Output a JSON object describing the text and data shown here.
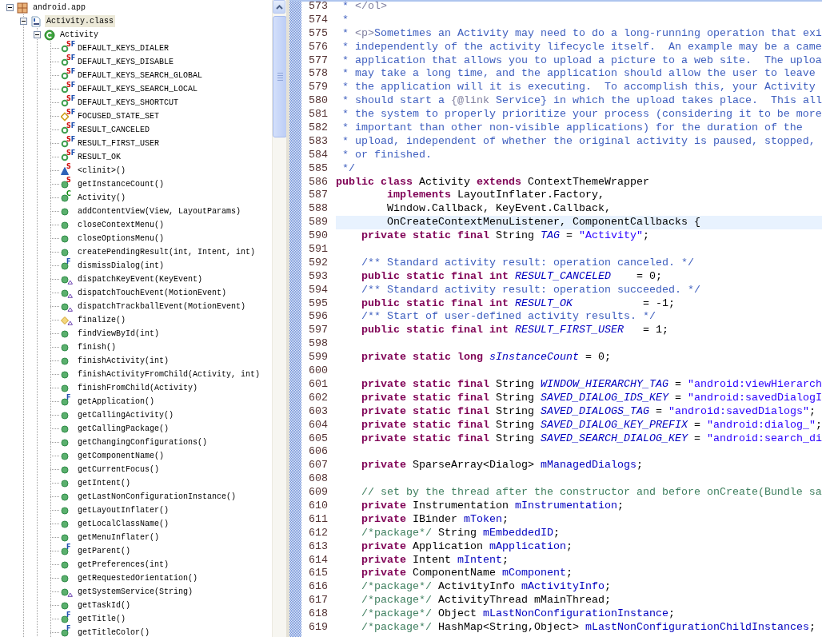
{
  "outline": {
    "label": "android.app",
    "kind": "package",
    "expanded": true,
    "selected": false,
    "children": [
      {
        "label": "Activity.class",
        "kind": "classfile",
        "expanded": true,
        "selected": true,
        "children": [
          {
            "label": "Activity",
            "kind": "class",
            "expanded": true,
            "selected": false,
            "children": [
              {
                "label": "DEFAULT_KEYS_DIALER",
                "kind": "public-field",
                "badges": [
                  {
                    "text": "S",
                    "kind": "static"
                  },
                  {
                    "text": "F",
                    "kind": "final"
                  }
                ],
                "overrides": false,
                "selected": false
              },
              {
                "label": "DEFAULT_KEYS_DISABLE",
                "kind": "public-field",
                "badges": [
                  {
                    "text": "S",
                    "kind": "static"
                  },
                  {
                    "text": "F",
                    "kind": "final"
                  }
                ],
                "overrides": false,
                "selected": false
              },
              {
                "label": "DEFAULT_KEYS_SEARCH_GLOBAL",
                "kind": "public-field",
                "badges": [
                  {
                    "text": "S",
                    "kind": "static"
                  },
                  {
                    "text": "F",
                    "kind": "final"
                  }
                ],
                "overrides": false,
                "selected": false
              },
              {
                "label": "DEFAULT_KEYS_SEARCH_LOCAL",
                "kind": "public-field",
                "badges": [
                  {
                    "text": "S",
                    "kind": "static"
                  },
                  {
                    "text": "F",
                    "kind": "final"
                  }
                ],
                "overrides": false,
                "selected": false
              },
              {
                "label": "DEFAULT_KEYS_SHORTCUT",
                "kind": "public-field",
                "badges": [
                  {
                    "text": "S",
                    "kind": "static"
                  },
                  {
                    "text": "F",
                    "kind": "final"
                  }
                ],
                "overrides": false,
                "selected": false
              },
              {
                "label": "FOCUSED_STATE_SET",
                "kind": "protected-field",
                "badges": [
                  {
                    "text": "S",
                    "kind": "static"
                  },
                  {
                    "text": "F",
                    "kind": "final"
                  }
                ],
                "overrides": false,
                "selected": false
              },
              {
                "label": "RESULT_CANCELED",
                "kind": "public-field",
                "badges": [
                  {
                    "text": "S",
                    "kind": "static"
                  },
                  {
                    "text": "F",
                    "kind": "final"
                  }
                ],
                "overrides": false,
                "selected": false
              },
              {
                "label": "RESULT_FIRST_USER",
                "kind": "public-field",
                "badges": [
                  {
                    "text": "S",
                    "kind": "static"
                  },
                  {
                    "text": "F",
                    "kind": "final"
                  }
                ],
                "overrides": false,
                "selected": false
              },
              {
                "label": "RESULT_OK",
                "kind": "public-field",
                "badges": [
                  {
                    "text": "S",
                    "kind": "static"
                  },
                  {
                    "text": "F",
                    "kind": "final"
                  }
                ],
                "overrides": false,
                "selected": false
              },
              {
                "label": "<clinit>()",
                "kind": "default-method",
                "badges": [
                  {
                    "text": "S",
                    "kind": "static"
                  }
                ],
                "overrides": false,
                "selected": false
              },
              {
                "label": "getInstanceCount()",
                "kind": "public-method",
                "badges": [
                  {
                    "text": "S",
                    "kind": "static"
                  }
                ],
                "overrides": false,
                "selected": false
              },
              {
                "label": "Activity()",
                "kind": "public-method",
                "badges": [
                  {
                    "text": "C",
                    "kind": "constructor"
                  }
                ],
                "overrides": false,
                "selected": false
              },
              {
                "label": "addContentView(View, LayoutParams)",
                "kind": "public-method",
                "overrides": false,
                "selected": false
              },
              {
                "label": "closeContextMenu()",
                "kind": "public-method",
                "overrides": false,
                "selected": false
              },
              {
                "label": "closeOptionsMenu()",
                "kind": "public-method",
                "overrides": false,
                "selected": false
              },
              {
                "label": "createPendingResult(int, Intent, int)",
                "kind": "public-method",
                "overrides": false,
                "selected": false
              },
              {
                "label": "dismissDialog(int)",
                "kind": "public-method",
                "badges": [
                  {
                    "text": "F",
                    "kind": "final"
                  }
                ],
                "overrides": false,
                "selected": false
              },
              {
                "label": "dispatchKeyEvent(KeyEvent)",
                "kind": "public-method",
                "overrides": true,
                "selected": false
              },
              {
                "label": "dispatchTouchEvent(MotionEvent)",
                "kind": "public-method",
                "overrides": true,
                "selected": false
              },
              {
                "label": "dispatchTrackballEvent(MotionEvent)",
                "kind": "public-method",
                "overrides": true,
                "selected": false
              },
              {
                "label": "finalize()",
                "kind": "protected-method",
                "overrides": true,
                "selected": false
              },
              {
                "label": "findViewById(int)",
                "kind": "public-method",
                "overrides": false,
                "selected": false
              },
              {
                "label": "finish()",
                "kind": "public-method",
                "overrides": false,
                "selected": false
              },
              {
                "label": "finishActivity(int)",
                "kind": "public-method",
                "overrides": false,
                "selected": false
              },
              {
                "label": "finishActivityFromChild(Activity, int)",
                "kind": "public-method",
                "overrides": false,
                "selected": false
              },
              {
                "label": "finishFromChild(Activity)",
                "kind": "public-method",
                "overrides": false,
                "selected": false
              },
              {
                "label": "getApplication()",
                "kind": "public-method",
                "badges": [
                  {
                    "text": "F",
                    "kind": "final"
                  }
                ],
                "overrides": false,
                "selected": false
              },
              {
                "label": "getCallingActivity()",
                "kind": "public-method",
                "overrides": false,
                "selected": false
              },
              {
                "label": "getCallingPackage()",
                "kind": "public-method",
                "overrides": false,
                "selected": false
              },
              {
                "label": "getChangingConfigurations()",
                "kind": "public-method",
                "overrides": false,
                "selected": false
              },
              {
                "label": "getComponentName()",
                "kind": "public-method",
                "overrides": false,
                "selected": false
              },
              {
                "label": "getCurrentFocus()",
                "kind": "public-method",
                "overrides": false,
                "selected": false
              },
              {
                "label": "getIntent()",
                "kind": "public-method",
                "overrides": false,
                "selected": false
              },
              {
                "label": "getLastNonConfigurationInstance()",
                "kind": "public-method",
                "overrides": false,
                "selected": false
              },
              {
                "label": "getLayoutInflater()",
                "kind": "public-method",
                "overrides": false,
                "selected": false
              },
              {
                "label": "getLocalClassName()",
                "kind": "public-method",
                "overrides": false,
                "selected": false
              },
              {
                "label": "getMenuInflater()",
                "kind": "public-method",
                "overrides": false,
                "selected": false
              },
              {
                "label": "getParent()",
                "kind": "public-method",
                "badges": [
                  {
                    "text": "F",
                    "kind": "final"
                  }
                ],
                "overrides": false,
                "selected": false
              },
              {
                "label": "getPreferences(int)",
                "kind": "public-method",
                "overrides": false,
                "selected": false
              },
              {
                "label": "getRequestedOrientation()",
                "kind": "public-method",
                "overrides": false,
                "selected": false
              },
              {
                "label": "getSystemService(String)",
                "kind": "public-method",
                "overrides": true,
                "selected": false
              },
              {
                "label": "getTaskId()",
                "kind": "public-method",
                "overrides": false,
                "selected": false
              },
              {
                "label": "getTitle()",
                "kind": "public-method",
                "badges": [
                  {
                    "text": "F",
                    "kind": "final"
                  }
                ],
                "overrides": false,
                "selected": false
              },
              {
                "label": "getTitleColor()",
                "kind": "public-method",
                "badges": [
                  {
                    "text": "F",
                    "kind": "final"
                  }
                ],
                "overrides": false,
                "selected": false
              }
            ]
          }
        ]
      }
    ]
  },
  "editor": {
    "lines": [
      {
        "number": "573",
        "current": false,
        "tokens": [
          {
            "kind": "doc",
            "text": " * "
          },
          {
            "kind": "tag",
            "text": "</ol>"
          }
        ]
      },
      {
        "number": "574",
        "current": false,
        "tokens": [
          {
            "kind": "doc",
            "text": " *"
          }
        ]
      },
      {
        "number": "575",
        "current": false,
        "tokens": [
          {
            "kind": "doc",
            "text": " * "
          },
          {
            "kind": "tag",
            "text": "<p>"
          },
          {
            "kind": "doc",
            "text": "Sometimes an Activity may need to do a long-running operation that exi"
          }
        ]
      },
      {
        "number": "576",
        "current": false,
        "tokens": [
          {
            "kind": "doc",
            "text": " * independently of the activity lifecycle itself.  An example may be a came"
          }
        ]
      },
      {
        "number": "577",
        "current": false,
        "tokens": [
          {
            "kind": "doc",
            "text": " * application that allows you to upload a picture to a web site.  The uploa"
          }
        ]
      },
      {
        "number": "578",
        "current": false,
        "tokens": [
          {
            "kind": "doc",
            "text": " * may take a long time, and the application should allow the user to leave"
          }
        ]
      },
      {
        "number": "579",
        "current": false,
        "tokens": [
          {
            "kind": "doc",
            "text": " * the application will it is executing.  To accomplish this, your Activity"
          }
        ]
      },
      {
        "number": "580",
        "current": false,
        "tokens": [
          {
            "kind": "doc",
            "text": " * should start a "
          },
          {
            "kind": "tag",
            "text": "{@link"
          },
          {
            "kind": "doc",
            "text": " Service} in which the upload takes place.  This all"
          }
        ]
      },
      {
        "number": "581",
        "current": false,
        "tokens": [
          {
            "kind": "doc",
            "text": " * the system to properly prioritize your process (considering it to be more"
          }
        ]
      },
      {
        "number": "582",
        "current": false,
        "tokens": [
          {
            "kind": "doc",
            "text": " * important than other non-visible applications) for the duration of the"
          }
        ]
      },
      {
        "number": "583",
        "current": false,
        "tokens": [
          {
            "kind": "doc",
            "text": " * upload, independent of whether the original activity is paused, stopped,"
          }
        ]
      },
      {
        "number": "584",
        "current": false,
        "tokens": [
          {
            "kind": "doc",
            "text": " * or finished."
          }
        ]
      },
      {
        "number": "585",
        "current": false,
        "tokens": [
          {
            "kind": "doc",
            "text": " */"
          }
        ]
      },
      {
        "number": "586",
        "current": false,
        "tokens": [
          {
            "kind": "keyword",
            "text": "public class"
          },
          {
            "kind": "plain",
            "text": " Activity "
          },
          {
            "kind": "keyword",
            "text": "extends"
          },
          {
            "kind": "plain",
            "text": " ContextThemeWrapper"
          }
        ]
      },
      {
        "number": "587",
        "current": false,
        "tokens": [
          {
            "kind": "keyword",
            "text": "        implements"
          },
          {
            "kind": "plain",
            "text": " LayoutInflater.Factory,"
          }
        ]
      },
      {
        "number": "588",
        "current": false,
        "tokens": [
          {
            "kind": "plain",
            "text": "        Window.Callback, KeyEvent.Callback,"
          }
        ]
      },
      {
        "number": "589",
        "current": true,
        "tokens": [
          {
            "kind": "plain",
            "text": "        OnCreateContextMenuListener, ComponentCallbacks {"
          }
        ]
      },
      {
        "number": "590",
        "current": false,
        "tokens": [
          {
            "kind": "keyword",
            "text": "    private static final"
          },
          {
            "kind": "plain",
            "text": " String "
          },
          {
            "kind": "static-field",
            "text": "TAG"
          },
          {
            "kind": "plain",
            "text": " = "
          },
          {
            "kind": "string",
            "text": "\"Activity\""
          },
          {
            "kind": "plain",
            "text": ";"
          }
        ]
      },
      {
        "number": "591",
        "current": false
      },
      {
        "number": "592",
        "current": false,
        "tokens": [
          {
            "kind": "doc",
            "text": "    /** Standard activity result: operation canceled. */"
          }
        ]
      },
      {
        "number": "593",
        "current": false,
        "tokens": [
          {
            "kind": "keyword",
            "text": "    public static final int"
          },
          {
            "kind": "static-field",
            "text": " RESULT_CANCELED"
          },
          {
            "kind": "plain",
            "text": "    = 0;"
          }
        ]
      },
      {
        "number": "594",
        "current": false,
        "tokens": [
          {
            "kind": "doc",
            "text": "    /** Standard activity result: operation succeeded. */"
          }
        ]
      },
      {
        "number": "595",
        "current": false,
        "tokens": [
          {
            "kind": "keyword",
            "text": "    public static final int"
          },
          {
            "kind": "static-field",
            "text": " RESULT_OK"
          },
          {
            "kind": "plain",
            "text": "           = -1;"
          }
        ]
      },
      {
        "number": "596",
        "current": false,
        "tokens": [
          {
            "kind": "doc",
            "text": "    /** Start of user-defined activity results. */"
          }
        ]
      },
      {
        "number": "597",
        "current": false,
        "tokens": [
          {
            "kind": "keyword",
            "text": "    public static final int"
          },
          {
            "kind": "static-field",
            "text": " RESULT_FIRST_USER"
          },
          {
            "kind": "plain",
            "text": "   = 1;"
          }
        ]
      },
      {
        "number": "598",
        "current": false
      },
      {
        "number": "599",
        "current": false,
        "tokens": [
          {
            "kind": "keyword",
            "text": "    private static long"
          },
          {
            "kind": "static-field",
            "text": " sInstanceCount"
          },
          {
            "kind": "plain",
            "text": " = 0;"
          }
        ]
      },
      {
        "number": "600",
        "current": false
      },
      {
        "number": "601",
        "current": false,
        "tokens": [
          {
            "kind": "keyword",
            "text": "    private static final"
          },
          {
            "kind": "plain",
            "text": " String "
          },
          {
            "kind": "static-field",
            "text": "WINDOW_HIERARCHY_TAG"
          },
          {
            "kind": "plain",
            "text": " = "
          },
          {
            "kind": "string",
            "text": "\"android:viewHierarch"
          }
        ]
      },
      {
        "number": "602",
        "current": false,
        "tokens": [
          {
            "kind": "keyword",
            "text": "    private static final"
          },
          {
            "kind": "plain",
            "text": " String "
          },
          {
            "kind": "static-field",
            "text": "SAVED_DIALOG_IDS_KEY"
          },
          {
            "kind": "plain",
            "text": " = "
          },
          {
            "kind": "string",
            "text": "\"android:savedDialogI"
          }
        ]
      },
      {
        "number": "603",
        "current": false,
        "tokens": [
          {
            "kind": "keyword",
            "text": "    private static final"
          },
          {
            "kind": "plain",
            "text": " String "
          },
          {
            "kind": "static-field",
            "text": "SAVED_DIALOGS_TAG"
          },
          {
            "kind": "plain",
            "text": " = "
          },
          {
            "kind": "string",
            "text": "\"android:savedDialogs\""
          },
          {
            "kind": "plain",
            "text": ";"
          }
        ]
      },
      {
        "number": "604",
        "current": false,
        "tokens": [
          {
            "kind": "keyword",
            "text": "    private static final"
          },
          {
            "kind": "plain",
            "text": " String "
          },
          {
            "kind": "static-field",
            "text": "SAVED_DIALOG_KEY_PREFIX"
          },
          {
            "kind": "plain",
            "text": " = "
          },
          {
            "kind": "string",
            "text": "\"android:dialog_\""
          },
          {
            "kind": "plain",
            "text": ";"
          }
        ]
      },
      {
        "number": "605",
        "current": false,
        "tokens": [
          {
            "kind": "keyword",
            "text": "    private static final"
          },
          {
            "kind": "plain",
            "text": " String "
          },
          {
            "kind": "static-field",
            "text": "SAVED_SEARCH_DIALOG_KEY"
          },
          {
            "kind": "plain",
            "text": " = "
          },
          {
            "kind": "string",
            "text": "\"android:search_di"
          }
        ]
      },
      {
        "number": "606",
        "current": false
      },
      {
        "number": "607",
        "current": false,
        "tokens": [
          {
            "kind": "keyword",
            "text": "    private"
          },
          {
            "kind": "plain",
            "text": " SparseArray<Dialog> "
          },
          {
            "kind": "field",
            "text": "mManagedDialogs"
          },
          {
            "kind": "plain",
            "text": ";"
          }
        ]
      },
      {
        "number": "608",
        "current": false
      },
      {
        "number": "609",
        "current": false,
        "tokens": [
          {
            "kind": "comment",
            "text": "    // set by the thread after the constructor and before onCreate(Bundle sa"
          }
        ]
      },
      {
        "number": "610",
        "current": false,
        "tokens": [
          {
            "kind": "keyword",
            "text": "    private"
          },
          {
            "kind": "plain",
            "text": " Instrumentation "
          },
          {
            "kind": "field",
            "text": "mInstrumentation"
          },
          {
            "kind": "plain",
            "text": ";"
          }
        ]
      },
      {
        "number": "611",
        "current": false,
        "tokens": [
          {
            "kind": "keyword",
            "text": "    private"
          },
          {
            "kind": "plain",
            "text": " IBinder "
          },
          {
            "kind": "field",
            "text": "mToken"
          },
          {
            "kind": "plain",
            "text": ";"
          }
        ]
      },
      {
        "number": "612",
        "current": false,
        "tokens": [
          {
            "kind": "comment",
            "text": "    /*package*/"
          },
          {
            "kind": "plain",
            "text": " String "
          },
          {
            "kind": "field",
            "text": "mEmbeddedID"
          },
          {
            "kind": "plain",
            "text": ";"
          }
        ]
      },
      {
        "number": "613",
        "current": false,
        "tokens": [
          {
            "kind": "keyword",
            "text": "    private"
          },
          {
            "kind": "plain",
            "text": " Application "
          },
          {
            "kind": "field",
            "text": "mApplication"
          },
          {
            "kind": "plain",
            "text": ";"
          }
        ]
      },
      {
        "number": "614",
        "current": false,
        "tokens": [
          {
            "kind": "keyword",
            "text": "    private"
          },
          {
            "kind": "plain",
            "text": " Intent "
          },
          {
            "kind": "field",
            "text": "mIntent"
          },
          {
            "kind": "plain",
            "text": ";"
          }
        ]
      },
      {
        "number": "615",
        "current": false,
        "tokens": [
          {
            "kind": "keyword",
            "text": "    private"
          },
          {
            "kind": "plain",
            "text": " ComponentName "
          },
          {
            "kind": "field",
            "text": "mComponent"
          },
          {
            "kind": "plain",
            "text": ";"
          }
        ]
      },
      {
        "number": "616",
        "current": false,
        "tokens": [
          {
            "kind": "comment",
            "text": "    /*package*/"
          },
          {
            "kind": "plain",
            "text": " ActivityInfo "
          },
          {
            "kind": "field",
            "text": "mActivityInfo"
          },
          {
            "kind": "plain",
            "text": ";"
          }
        ]
      },
      {
        "number": "617",
        "current": false,
        "tokens": [
          {
            "kind": "comment",
            "text": "    /*package*/"
          },
          {
            "kind": "plain",
            "text": " ActivityThread mMainThread;"
          }
        ]
      },
      {
        "number": "618",
        "current": false,
        "tokens": [
          {
            "kind": "comment",
            "text": "    /*package*/"
          },
          {
            "kind": "plain",
            "text": " Object "
          },
          {
            "kind": "field",
            "text": "mLastNonConfigurationInstance"
          },
          {
            "kind": "plain",
            "text": ";"
          }
        ]
      },
      {
        "number": "619",
        "current": false,
        "tokens": [
          {
            "kind": "comment",
            "text": "    /*package*/"
          },
          {
            "kind": "plain",
            "text": " HashMap<String,Object> "
          },
          {
            "kind": "field",
            "text": "mLastNonConfigurationChildInstances"
          },
          {
            "kind": "plain",
            "text": ";"
          }
        ]
      }
    ]
  }
}
